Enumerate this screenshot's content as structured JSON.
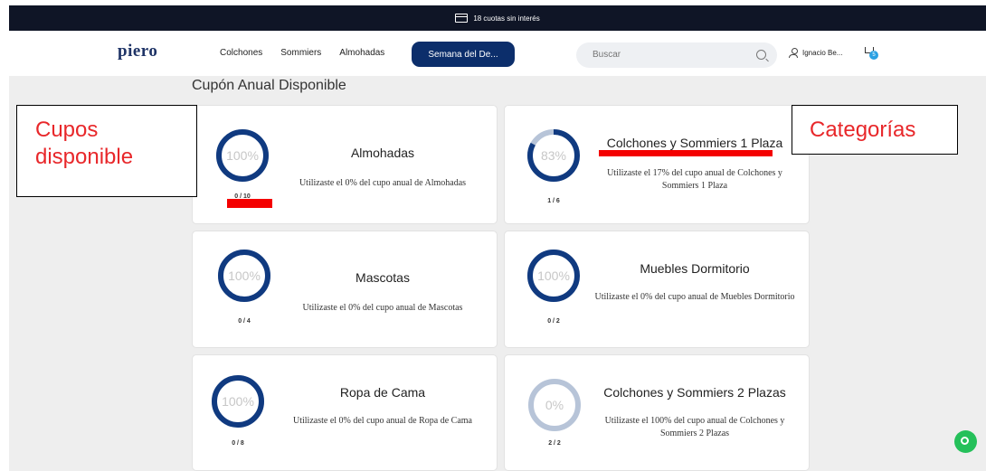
{
  "topbar": {
    "text": "18 cuotas sin interés",
    "icon": "credit-card-icon"
  },
  "header": {
    "logo": "piero",
    "nav": [
      "Colchones",
      "Sommiers",
      "Almohadas"
    ],
    "cta": "Semana del De...",
    "search_placeholder": "Buscar",
    "user_name": "Ignacio Be...",
    "cart_count": "5"
  },
  "colors": {
    "ring_active": "#103a80",
    "ring_track": "#b7c4d8",
    "cta": "#0c2e6b",
    "annotation": "#e8272a",
    "whatsapp": "#25c05a"
  },
  "main": {
    "title": "Cupón Anual Disponible",
    "cards": [
      {
        "name": "Almohadas",
        "percent": "100%",
        "fill": 1.0,
        "count": "0 / 10",
        "desc": "Utilizaste el 0% del cupo anual de Almohadas"
      },
      {
        "name": "Colchones y Sommiers 1 Plaza",
        "percent": "83%",
        "fill": 0.83,
        "count": "1 / 6",
        "desc": "Utilizaste el 17% del cupo anual de Colchones y Sommiers 1 Plaza"
      },
      {
        "name": "Mascotas",
        "percent": "100%",
        "fill": 1.0,
        "count": "0 / 4",
        "desc": "Utilizaste el 0% del cupo anual de Mascotas"
      },
      {
        "name": "Muebles Dormitorio",
        "percent": "100%",
        "fill": 1.0,
        "count": "0 / 2",
        "desc": "Utilizaste el 0% del cupo anual de Muebles Dormitorio"
      },
      {
        "name": "Ropa de Cama",
        "percent": "100%",
        "fill": 1.0,
        "count": "0 / 8",
        "desc": "Utilizaste el 0% del cupo anual de Ropa de Cama"
      },
      {
        "name": "Colchones y Sommiers 2 Plazas",
        "percent": "0%",
        "fill": 0.0,
        "count": "2 / 2",
        "desc": "Utilizaste el 100% del cupo anual de Colchones y Sommiers 2 Plazas"
      }
    ]
  },
  "annotations": {
    "left": "Cupos disponible",
    "right": "Categorías"
  }
}
